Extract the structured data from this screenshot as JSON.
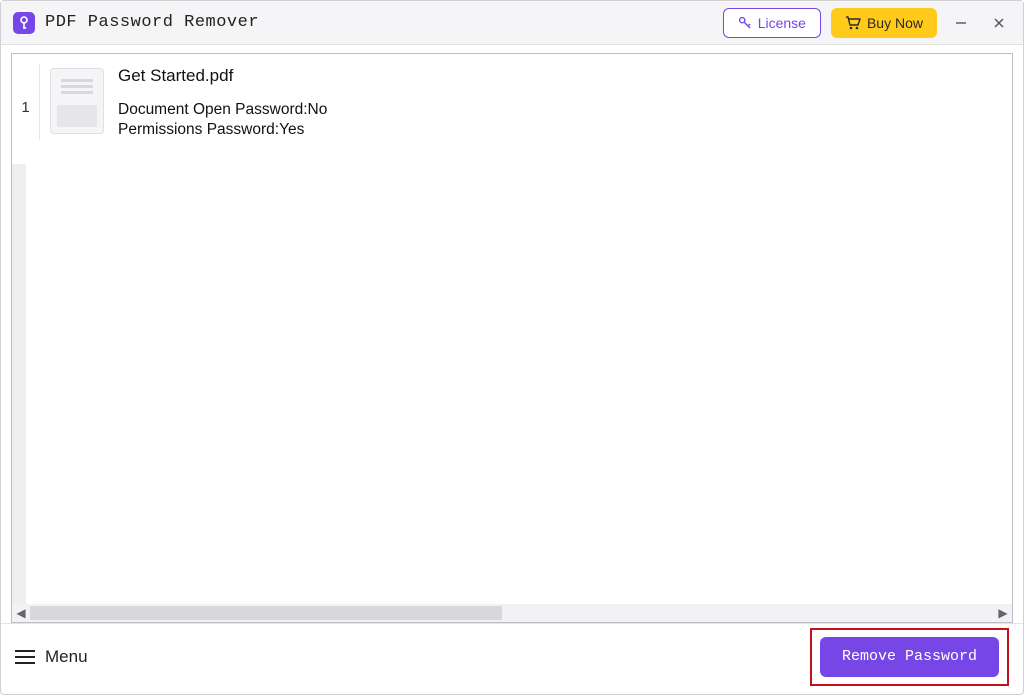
{
  "app": {
    "title": "PDF Password Remover"
  },
  "titlebar": {
    "license_label": "License",
    "buynow_label": "Buy Now"
  },
  "files": [
    {
      "index": "1",
      "name": "Get Started.pdf",
      "doc_open_label": "Document Open Password:",
      "doc_open_value": "No",
      "perm_label": "Permissions Password:",
      "perm_value": "Yes"
    }
  ],
  "bottombar": {
    "menu_label": "Menu",
    "remove_label": "Remove Password"
  },
  "colors": {
    "accent": "#7646e6",
    "buy": "#ffca1a",
    "highlight_border": "#c40f1f"
  }
}
